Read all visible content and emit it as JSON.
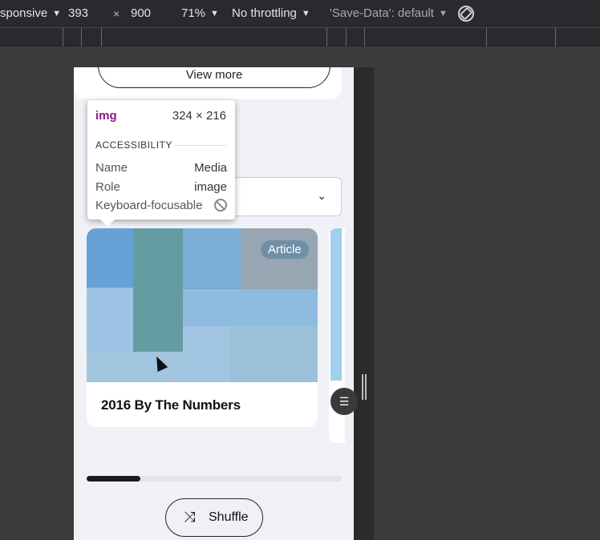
{
  "devtools": {
    "device_label": "sponsive",
    "width_value": "393",
    "times": "×",
    "height_value": "900",
    "zoom": "71%",
    "throttle": "No throttling",
    "save_data": "'Save-Data': default"
  },
  "page": {
    "view_more_label": "View more",
    "card": {
      "badge": "Article",
      "title": "2016 By The Numbers"
    },
    "carousel_progress": 0.21,
    "shuffle_label": "Shuffle"
  },
  "tooltip": {
    "tag": "img",
    "dims": "324 × 216",
    "section": "ACCESSIBILITY",
    "rows": [
      {
        "label": "Name",
        "value": "Media"
      },
      {
        "label": "Role",
        "value": "image"
      },
      {
        "label": "Keyboard-focusable",
        "value": ""
      }
    ]
  },
  "colors": {
    "devtools_bg": "#292a2d",
    "page_bg": "#f0f1f7",
    "tag_color": "#8b1a8b",
    "image_overlay": "#6fa8dc"
  }
}
